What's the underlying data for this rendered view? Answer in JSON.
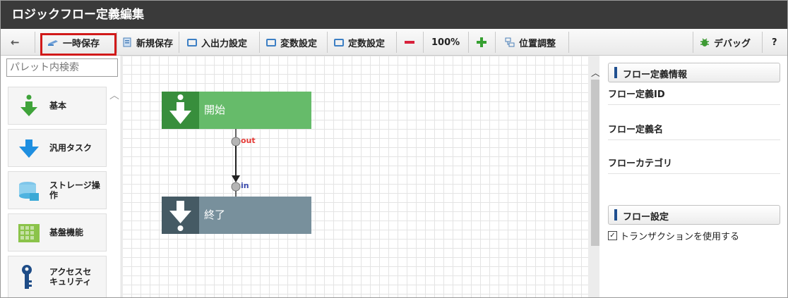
{
  "window": {
    "title": "ロジックフロー定義編集"
  },
  "toolbar": {
    "back_label": "←",
    "temp_save": "一時保存",
    "new_save": "新規保存",
    "io_settings": "入出力設定",
    "var_settings": "変数設定",
    "const_settings": "定数設定",
    "zoom": "100%",
    "layout_adjust": "位置調整",
    "debug": "デバッグ",
    "help": "?"
  },
  "palette": {
    "search_placeholder": "パレット内検索",
    "items": [
      {
        "label": "基本",
        "icon": "green-down-arrow-icon"
      },
      {
        "label": "汎用タスク",
        "icon": "blue-down-arrow-icon"
      },
      {
        "label": "ストレージ操作",
        "label_line1": "ストレージ操",
        "label_line2": "作",
        "icon": "storage-icon"
      },
      {
        "label": "基盤機能",
        "icon": "grid-blocks-icon"
      },
      {
        "label": "アクセスセキュリティ",
        "label_line1": "アクセスセ",
        "label_line2": "キュリティ",
        "icon": "key-icon"
      }
    ]
  },
  "canvas": {
    "start_node": {
      "label": "開始",
      "color": "#66bb6a"
    },
    "end_node": {
      "label": "終了",
      "color": "#78909c"
    },
    "out_port": "out",
    "in_port": "in"
  },
  "properties": {
    "section_info": "フロー定義情報",
    "field_id": "フロー定義ID",
    "field_name": "フロー定義名",
    "field_category": "フローカテゴリ",
    "section_settings": "フロー設定",
    "transaction_label": "トランザクションを使用する",
    "transaction_checked": true
  },
  "colors": {
    "highlight": "#d11a1a",
    "titlebar": "#3a3a3a"
  }
}
